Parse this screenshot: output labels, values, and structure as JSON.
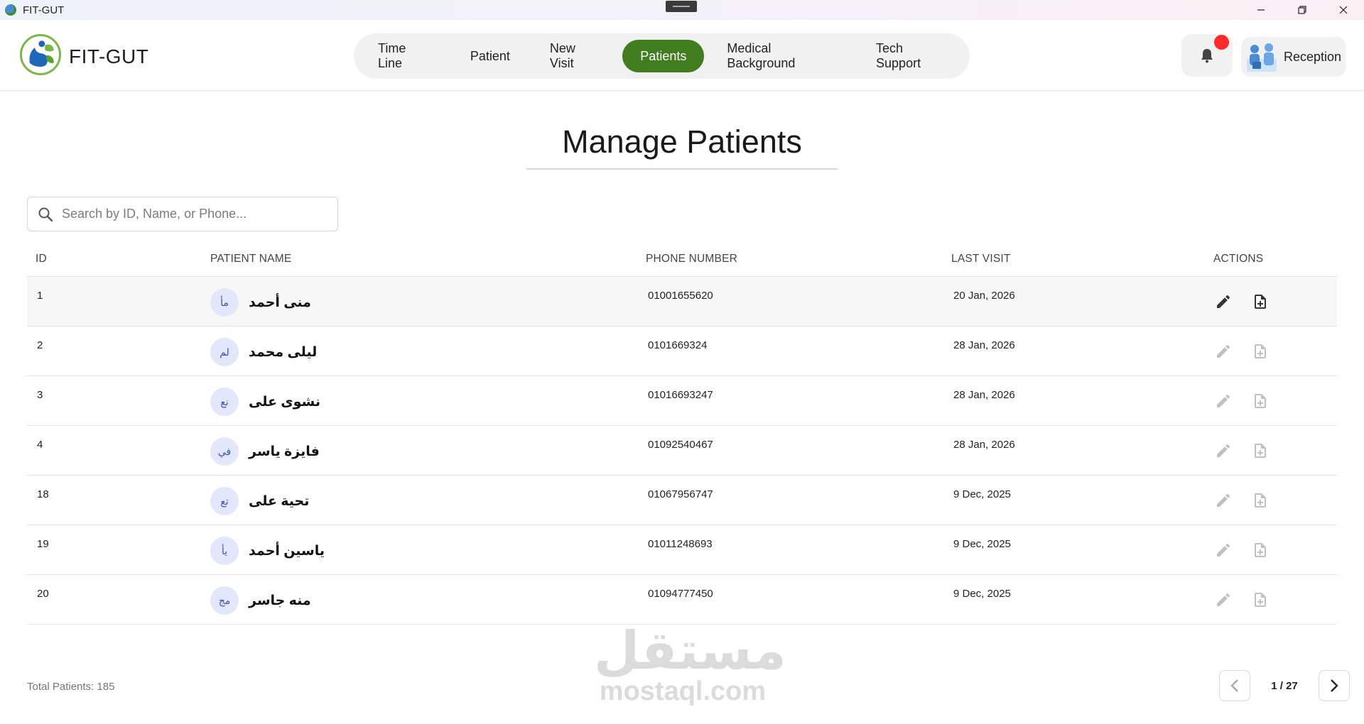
{
  "window": {
    "title": "FIT-GUT",
    "controls": [
      "minimize",
      "restore",
      "close"
    ]
  },
  "header": {
    "brand": "FIT-GUT",
    "nav": [
      {
        "label": "Time Line",
        "active": false
      },
      {
        "label": "Patient",
        "active": false
      },
      {
        "label": "New Visit",
        "active": false
      },
      {
        "label": "Patients",
        "active": true
      },
      {
        "label": "Medical Background",
        "active": false
      },
      {
        "label": "Tech Support",
        "active": false
      }
    ],
    "user_role": "Reception",
    "has_notification": true
  },
  "main": {
    "title": "Manage Patients",
    "search_placeholder": "Search by ID, Name, or Phone...",
    "columns": [
      "ID",
      "PATIENT NAME",
      "PHONE NUMBER",
      "LAST VISIT",
      "ACTIONS"
    ],
    "rows": [
      {
        "id": "1",
        "initials": "مأ",
        "name": "منى أحمد",
        "phone": "01001655620",
        "last_visit": "20 Jan, 2026"
      },
      {
        "id": "2",
        "initials": "لم",
        "name": "ليلى محمد",
        "phone": "0101669324",
        "last_visit": "28 Jan, 2026"
      },
      {
        "id": "3",
        "initials": "نع",
        "name": "نشوى على",
        "phone": "01016693247",
        "last_visit": "28 Jan, 2026"
      },
      {
        "id": "4",
        "initials": "في",
        "name": "فايزة ياسر",
        "phone": "01092540467",
        "last_visit": "28 Jan, 2026"
      },
      {
        "id": "18",
        "initials": "تع",
        "name": "تحية على",
        "phone": "01067956747",
        "last_visit": "9 Dec, 2025"
      },
      {
        "id": "19",
        "initials": "يأ",
        "name": "ياسين أحمد",
        "phone": "01011248693",
        "last_visit": "9 Dec, 2025"
      },
      {
        "id": "20",
        "initials": "مج",
        "name": "منه جاسر",
        "phone": "01094777450",
        "last_visit": "9 Dec, 2025"
      }
    ],
    "total_label": "Total Patients: 185",
    "pagination": "1 / 27"
  },
  "watermark": {
    "arabic": "مستقل",
    "latin": "mostaql.com"
  },
  "colors": {
    "accent": "#3f7d1e",
    "notification": "#ff2a2a",
    "avatar_bg": "#e2e7fb",
    "avatar_text": "#3b4fc0"
  }
}
